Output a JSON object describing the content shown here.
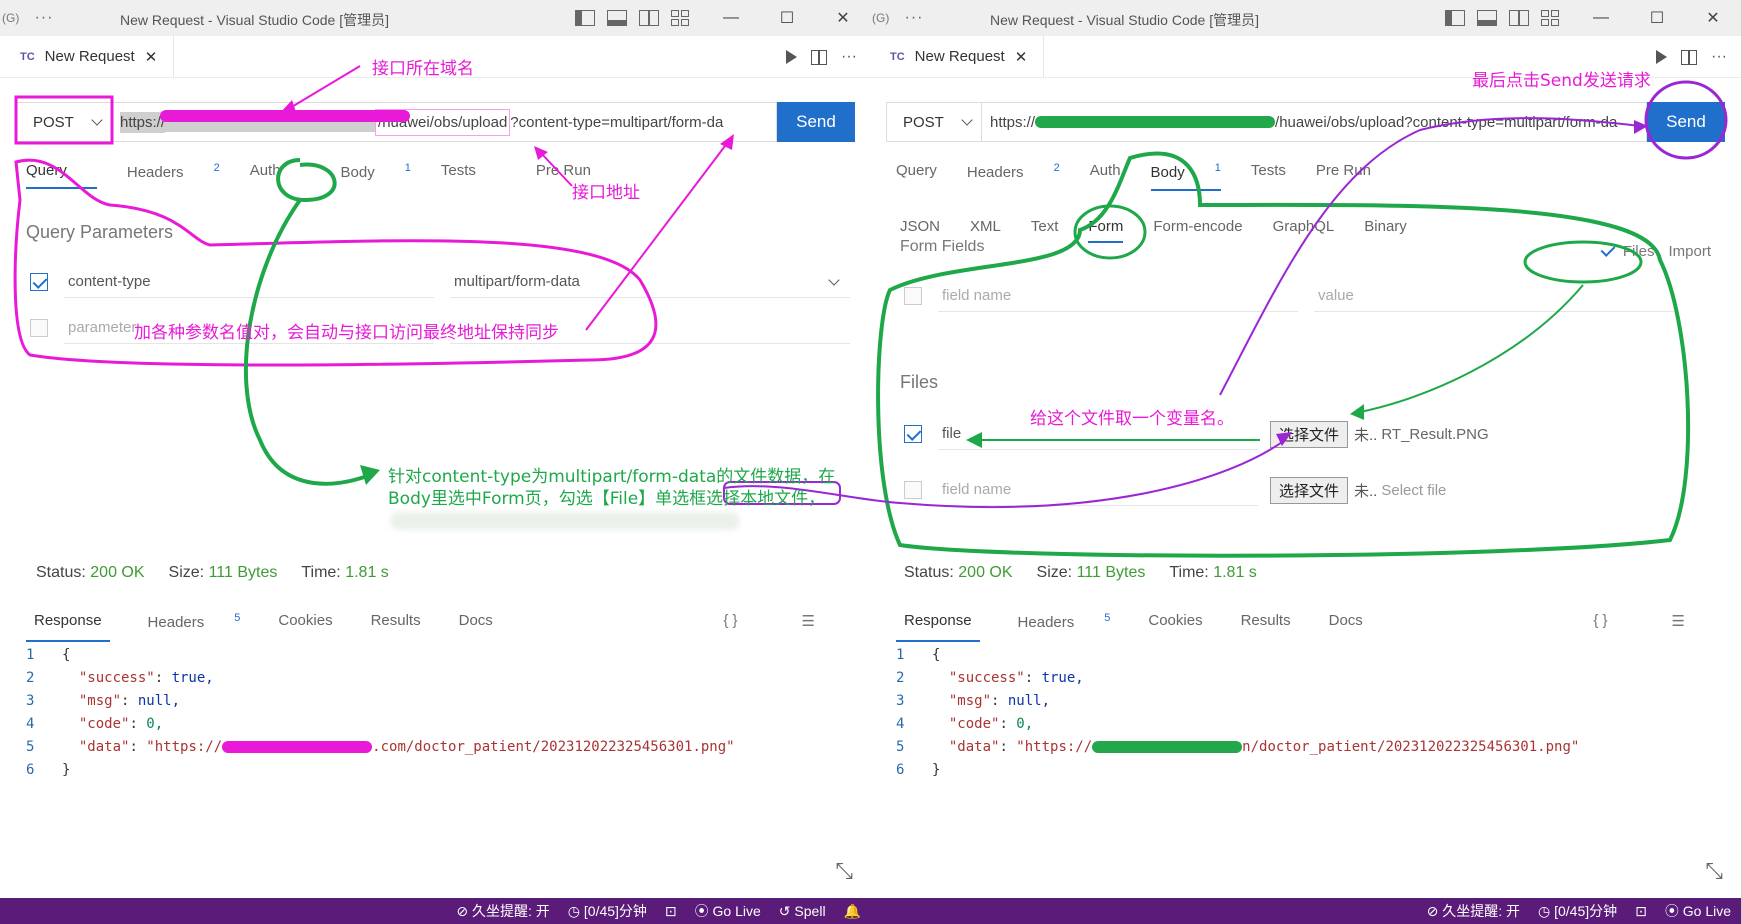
{
  "window_title": "New Request - Visual Studio Code [管理员]",
  "title_prefix": "(G)",
  "title_dots": "···",
  "tab": {
    "logo": "TC",
    "label": "New Request",
    "close": "✕"
  },
  "tab_more": "···",
  "method": "POST",
  "url_left": {
    "scheme": "https://",
    "path": "/huawei/obs/upload",
    "query": "?content-type=multipart/form-da"
  },
  "url_right": {
    "scheme": "https://",
    "path": "/huawei/obs/upload?content-type=multipart/form-da"
  },
  "send_label": "Send",
  "request_tabs": [
    {
      "label": "Query",
      "badge": ""
    },
    {
      "label": "Headers",
      "badge": "2"
    },
    {
      "label": "Auth",
      "badge": ""
    },
    {
      "label": "Body",
      "badge": "1"
    },
    {
      "label": "Tests",
      "badge": ""
    },
    {
      "label": "Pre Run",
      "badge": ""
    }
  ],
  "query": {
    "title": "Query Parameters",
    "param_name": "content-type",
    "param_value": "multipart/form-data",
    "new_param_placeholder": "parameter"
  },
  "body_tabs": [
    "JSON",
    "XML",
    "Text",
    "Form",
    "Form-encode",
    "GraphQL",
    "Binary"
  ],
  "form": {
    "fields_title": "Form Fields",
    "files_toggle": "Files",
    "import_label": "Import",
    "field_name_placeholder": "field name",
    "value_placeholder": "value",
    "files_title": "Files",
    "file_field_name": "file",
    "choose_file": "选择文件",
    "not_chosen": "未..",
    "file_name": "RT_Result.PNG",
    "select_file_placeholder": "Select file"
  },
  "status": {
    "status_label": "Status:",
    "status_value": "200 OK",
    "size_label": "Size:",
    "size_value": "111 Bytes",
    "time_label": "Time:",
    "time_value": "1.81 s"
  },
  "response_tabs": [
    {
      "label": "Response",
      "badge": ""
    },
    {
      "label": "Headers",
      "badge": "5"
    },
    {
      "label": "Cookies",
      "badge": ""
    },
    {
      "label": "Results",
      "badge": ""
    },
    {
      "label": "Docs",
      "badge": ""
    }
  ],
  "response_icons": {
    "braces": "{ }",
    "menu": "☰"
  },
  "response_code": {
    "open": "{",
    "success_key": "\"success\"",
    "success_val": "true,",
    "msg_key": "\"msg\"",
    "msg_val": "null,",
    "code_key": "\"code\"",
    "code_val": "0,",
    "data_key": "\"data\"",
    "data_left_prefix": "\"https://",
    "data_left_suffix": ".com/doctor_patient/202312022325456301.png\"",
    "data_right_prefix": "\"https://",
    "data_right_suffix": "n/doctor_patient/202312022325456301.png\"",
    "close": "}"
  },
  "statusbar": {
    "reminder": "⊘ 久坐提醒: 开",
    "timer": "◷ [0/45]分钟",
    "terminal": "⊡",
    "go_live": "⦿ Go Live",
    "spell": "↺ Spell",
    "bell": "🔔"
  },
  "annotations": {
    "domain": "接口所在域名",
    "endpoint": "接口地址",
    "params": "加各种参数名值对，会自动与接口访问最终地址保持同步",
    "body_line1": "针对content-type为multipart/form-data的文件数据，在",
    "body_line2": "Body里选中Form页，勾选【File】单选框选择本地文件，",
    "send_last": "最后点击Send发送请求",
    "var_name": "给这个文件取一个变量名。"
  },
  "colors": {
    "accent": "#1f6fcb",
    "statusbar": "#5b1b78",
    "ok": "#3f9b35",
    "annot_magenta": "#e81ad8",
    "annot_green": "#1fa84a",
    "annot_purple": "#9a26d4"
  }
}
